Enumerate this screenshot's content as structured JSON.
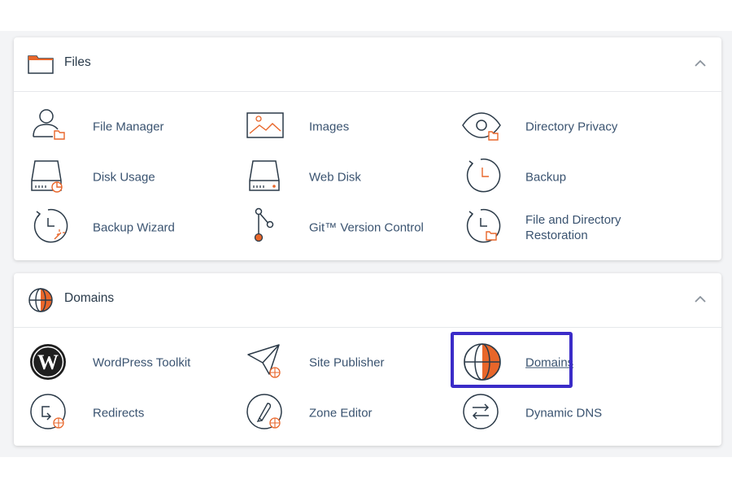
{
  "colors": {
    "accent": "#e8662a",
    "icon_stroke": "#2b3a48",
    "highlight": "#3b2cc8",
    "link": "#3a5370"
  },
  "files": {
    "title": "Files",
    "icon": "folder-icon",
    "items": [
      {
        "label": "File Manager",
        "icon": "file-manager-icon"
      },
      {
        "label": "Images",
        "icon": "images-icon"
      },
      {
        "label": "Directory Privacy",
        "icon": "directory-privacy-icon"
      },
      {
        "label": "Disk Usage",
        "icon": "disk-usage-icon"
      },
      {
        "label": "Web Disk",
        "icon": "web-disk-icon"
      },
      {
        "label": "Backup",
        "icon": "backup-icon"
      },
      {
        "label": "Backup Wizard",
        "icon": "backup-wizard-icon"
      },
      {
        "label": "Git™ Version Control",
        "icon": "git-icon"
      },
      {
        "label_line1": "File and Directory",
        "label_line2": "Restoration",
        "icon": "restoration-icon"
      }
    ]
  },
  "domains": {
    "title": "Domains",
    "icon": "globe-icon",
    "items": [
      {
        "label": "WordPress Toolkit",
        "icon": "wordpress-icon"
      },
      {
        "label": "Site Publisher",
        "icon": "site-publisher-icon"
      },
      {
        "label": "Domains",
        "icon": "domains-globe-icon"
      },
      {
        "label": "Redirects",
        "icon": "redirects-icon"
      },
      {
        "label": "Zone Editor",
        "icon": "zone-editor-icon"
      },
      {
        "label": "Dynamic DNS",
        "icon": "dynamic-dns-icon"
      }
    ]
  }
}
